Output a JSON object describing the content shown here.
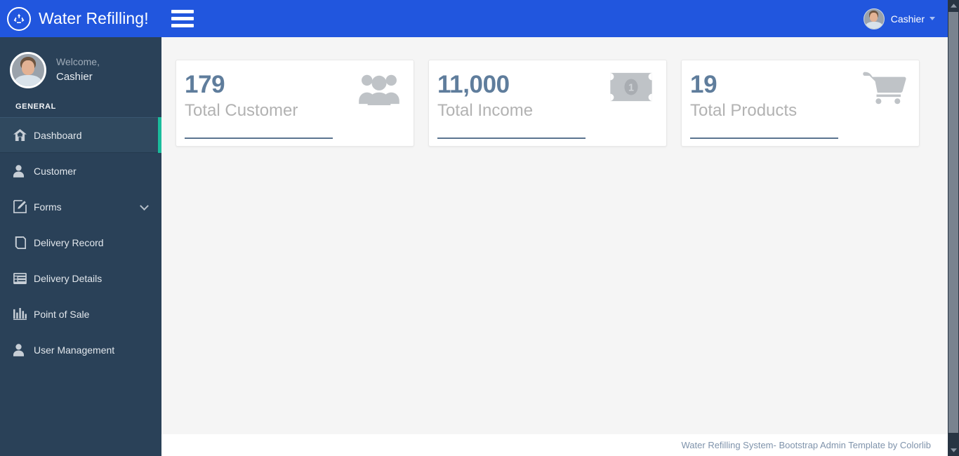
{
  "topbar": {
    "brand_title": "Water Refilling!",
    "brand_icon": "recycle-icon",
    "menu_toggle_icon": "hamburger-icon",
    "user_name": "Cashier",
    "user_caret_icon": "caret-down-icon",
    "background_color": "#2156de"
  },
  "sidebar": {
    "welcome_label": "Welcome,",
    "profile_name": "Cashier",
    "section_label": "GENERAL",
    "background_color": "#2a4158",
    "active_accent_color": "#1abc9c",
    "items": [
      {
        "label": "Dashboard",
        "icon": "home-icon",
        "active": true,
        "has_caret": false
      },
      {
        "label": "Customer",
        "icon": "user-icon",
        "active": false,
        "has_caret": false
      },
      {
        "label": "Forms",
        "icon": "edit-square-icon",
        "active": false,
        "has_caret": true
      },
      {
        "label": "Delivery Record",
        "icon": "book-icon",
        "active": false,
        "has_caret": false
      },
      {
        "label": "Delivery Details",
        "icon": "list-table-icon",
        "active": false,
        "has_caret": false
      },
      {
        "label": "Point of Sale",
        "icon": "bar-chart-icon",
        "active": false,
        "has_caret": false
      },
      {
        "label": "User Management",
        "icon": "user-solid-icon",
        "active": false,
        "has_caret": false
      }
    ]
  },
  "main": {
    "background_color": "#f5f5f5",
    "cards": [
      {
        "value": "179",
        "label": "Total Customer",
        "icon": "users-group-icon",
        "value_color": "#5f7d9c"
      },
      {
        "value": "11,000",
        "label": "Total Income",
        "icon": "money-bill-icon",
        "value_color": "#5f7d9c"
      },
      {
        "value": "19",
        "label": "Total Products",
        "icon": "shopping-cart-icon",
        "value_color": "#5f7d9c"
      }
    ]
  },
  "footer": {
    "text": "Water Refilling System- Bootstrap Admin Template by Colorlib"
  },
  "scrollbar": {
    "up_icon": "chevron-up-icon",
    "down_icon": "chevron-down-icon"
  }
}
